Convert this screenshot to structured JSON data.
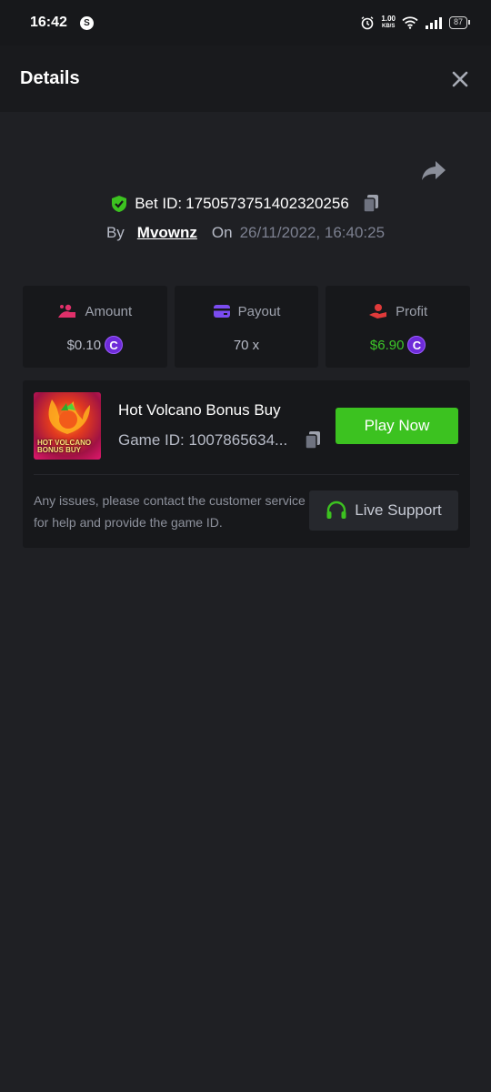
{
  "status_bar": {
    "time": "16:42",
    "app_icon_letter": "S",
    "net_speed_value": "1.00",
    "net_speed_unit": "KB/S",
    "battery": "87"
  },
  "header": {
    "title": "Details",
    "close_icon": "close-icon"
  },
  "bet": {
    "id_label": "Bet ID:",
    "id_value": "1750573751402320256",
    "by_label": "By",
    "user": "Mvownz",
    "on_label": "On",
    "datetime": "26/11/2022, 16:40:25"
  },
  "stats": {
    "amount": {
      "label": "Amount",
      "value": "$0.10",
      "icon": "coins-hand-icon",
      "color": "#e0306a"
    },
    "payout": {
      "label": "Payout",
      "value": "70 x",
      "icon": "card-icon",
      "color": "#7b4cf0"
    },
    "profit": {
      "label": "Profit",
      "value": "$6.90",
      "icon": "hand-coin-icon",
      "color": "#e03a3a",
      "value_color": "#3dc628"
    }
  },
  "game": {
    "title": "Hot Volcano Bonus Buy",
    "thumb_text_line1": "HOT VOLCANO",
    "thumb_text_line2": "BONUS BUY",
    "game_id_label": "Game ID:",
    "game_id_value": "1007865634...",
    "play_label": "Play Now",
    "issue_text": "Any issues, please contact the customer service for help and provide the game ID.",
    "support_label": "Live Support"
  },
  "colors": {
    "background": "#1f2024",
    "card": "#17181b",
    "accent_green": "#3cc220",
    "coin_purple": "#6e2bd9"
  }
}
